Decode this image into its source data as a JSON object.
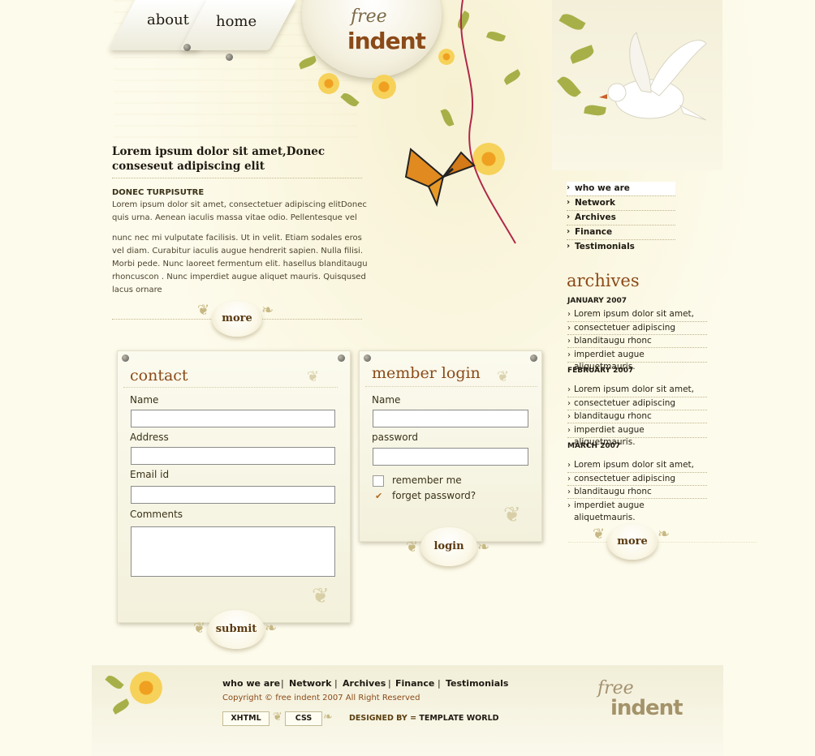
{
  "nav_top": {
    "about": "about",
    "home": "home"
  },
  "logo": {
    "free": "free",
    "indent": "indent"
  },
  "intro": {
    "headline": "Lorem ipsum dolor sit amet,Donec conseseut adipiscing elit",
    "subhead": "DONEC TURPISUTRE",
    "para1": "Lorem ipsum dolor sit amet, consectetuer adipiscing elitDonec quis urna. Aenean iaculis massa vitae odio. Pellentesque vel",
    "para2": "nunc nec mi vulputate facilisis. Ut in velit. Etiam sodales eros vel diam. Curabitur iaculis  augue hendrerit sapien. Nulla filisi. Morbi pede. Nunc laoreet fermentum elit. hasellus blanditaugu rhoncuscon . Nunc imperdiet augue aliquet mauris. Quisqused lacus ornare",
    "more": "more"
  },
  "contact": {
    "title": "contact",
    "name_label": "Name",
    "address_label": "Address",
    "email_label": "Email id",
    "comments_label": "Comments",
    "submit": "submit"
  },
  "login": {
    "title": "member login",
    "name_label": "Name",
    "password_label": "password",
    "remember": "remember me",
    "forget": "forget password?",
    "button": "login"
  },
  "sidenav": {
    "items": [
      {
        "label": "who we are"
      },
      {
        "label": "Network"
      },
      {
        "label": "Archives"
      },
      {
        "label": "Finance"
      },
      {
        "label": "Testimonials"
      }
    ]
  },
  "archives": {
    "title": "archives",
    "months": [
      {
        "name": "JANUARY 2007",
        "items": [
          "Lorem ipsum dolor sit amet,",
          "consectetuer adipiscing",
          "blanditaugu rhonc",
          "imperdiet augue aliquetmauris."
        ]
      },
      {
        "name": "FEBRUARY 2007",
        "items": [
          "Lorem ipsum dolor sit amet,",
          "consectetuer adipiscing",
          "blanditaugu rhonc",
          "imperdiet augue aliquetmauris."
        ]
      },
      {
        "name": "MARCH 2007",
        "items": [
          "Lorem ipsum dolor sit amet,",
          "consectetuer adipiscing",
          "blanditaugu rhonc",
          "imperdiet augue aliquetmauris."
        ]
      }
    ],
    "more": "more"
  },
  "footer": {
    "links": [
      "who we are",
      "Network",
      "Archives",
      "Finance",
      "Testimonials"
    ],
    "separator": "|",
    "copyright": "Copyright © free indent 2007 All Right Reserved",
    "xhtml": "XHTML",
    "css": "CSS",
    "designed_prefix": "DESIGNED BY =",
    "designed_by": "TEMPLATE WORLD",
    "logo_free": "free",
    "logo_indent": "indent"
  }
}
